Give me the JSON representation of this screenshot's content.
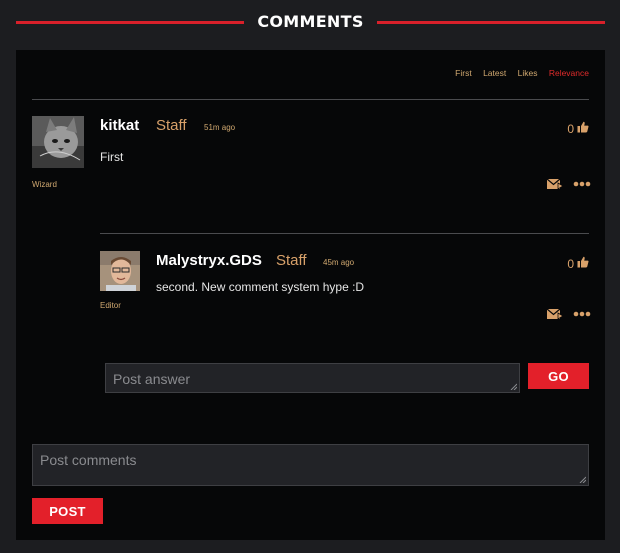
{
  "section": {
    "title": "COMMENTS"
  },
  "sort": {
    "options": [
      "First",
      "Latest",
      "Likes",
      "Relevance"
    ],
    "active": "Relevance"
  },
  "comments": [
    {
      "username": "kitkat",
      "badge": "Staff",
      "time": "51m ago",
      "rank": "Wizard",
      "text": "First",
      "likes": "0"
    }
  ],
  "replies": [
    {
      "username": "Malystryx.GDS",
      "badge": "Staff",
      "time": "45m ago",
      "rank": "Editor",
      "text": "second. New comment system hype :D",
      "likes": "0"
    }
  ],
  "answer_form": {
    "placeholder": "Post answer",
    "button": "GO"
  },
  "comment_form": {
    "placeholder": "Post comments",
    "button": "POST"
  },
  "colors": {
    "accent": "#e3202a",
    "staff": "#d8a16a",
    "panel": "#060708"
  }
}
